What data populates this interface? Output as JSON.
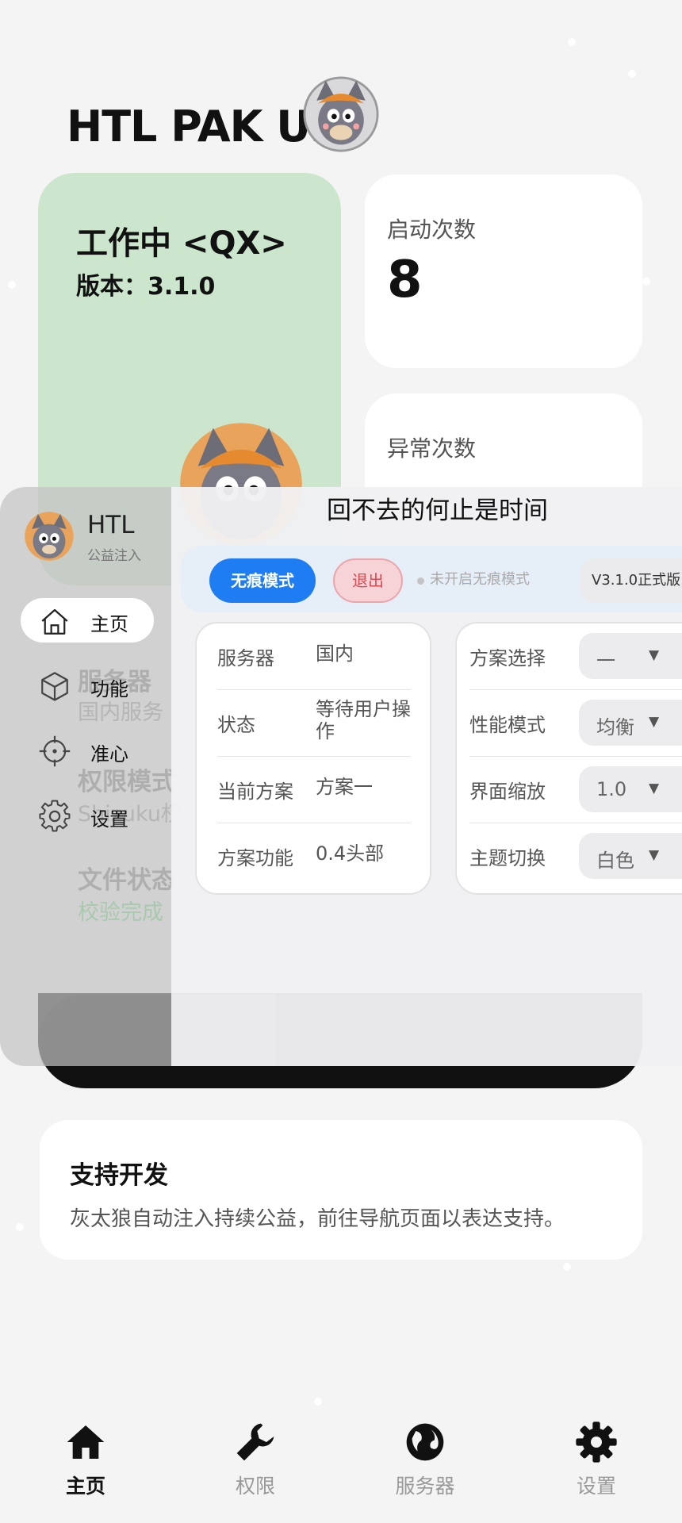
{
  "app": {
    "title": "HTL PAK Ulti",
    "status_text": "工作中 <QX>",
    "version_text": "版本：3.1.0"
  },
  "stats": [
    {
      "label": "启动次数",
      "value": "8"
    },
    {
      "label": "异常次数",
      "value": ""
    }
  ],
  "background_ghost": {
    "server_heading": "服务器",
    "server_value": "国内服务",
    "permission_heading": "权限模式",
    "permission_value": "Shizuku权",
    "file_heading": "文件状态",
    "file_value": "校验完成"
  },
  "support": {
    "title": "支持开发",
    "description": "灰太狼自动注入持续公益，前往导航页面以表达支持。"
  },
  "tabs": [
    {
      "label": "主页",
      "icon": "home-icon",
      "active": true
    },
    {
      "label": "权限",
      "icon": "wrench-icon",
      "active": false
    },
    {
      "label": "服务器",
      "icon": "globe-icon",
      "active": false
    },
    {
      "label": "设置",
      "icon": "gear-icon",
      "active": false
    }
  ],
  "overlay": {
    "brand_name": "HTL",
    "brand_sub": "公益注入",
    "title": "回不去的何止是时间",
    "nav": [
      {
        "label": "主页",
        "icon": "home-icon",
        "active": true
      },
      {
        "label": "功能",
        "icon": "cube-icon",
        "active": false
      },
      {
        "label": "准心",
        "icon": "crosshair-icon",
        "active": false
      },
      {
        "label": "设置",
        "icon": "gear-icon",
        "active": false
      }
    ],
    "primary_button": "无痕模式",
    "exit_button": "退出",
    "status_hint": "未开启无痕模式",
    "version_badge": "V3.1.0正式版",
    "info": [
      {
        "key": "服务器",
        "value": "国内"
      },
      {
        "key": "状态",
        "value": "等待用户操作"
      },
      {
        "key": "当前方案",
        "value": "方案一"
      },
      {
        "key": "方案功能",
        "value": "0.4头部"
      }
    ],
    "settings": [
      {
        "key": "方案选择",
        "value": "一"
      },
      {
        "key": "性能模式",
        "value": "均衡"
      },
      {
        "key": "界面缩放",
        "value": "1.0"
      },
      {
        "key": "主题切换",
        "value": "白色"
      }
    ]
  },
  "colors": {
    "accent": "#1e7df2",
    "status_card": "#cbe6cc",
    "danger": "#d94b52"
  }
}
